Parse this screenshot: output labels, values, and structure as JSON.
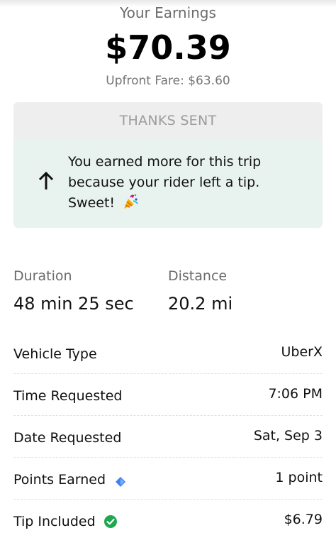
{
  "earnings": {
    "label": "Your Earnings",
    "amount": "$70.39",
    "upfront_fare": "Upfront Fare: $63.60"
  },
  "thanks_button": {
    "label": "THANKS SENT"
  },
  "tip_banner": {
    "message": "You earned more for this trip because your rider left a tip. Sweet!",
    "icon": "arrow-up-icon",
    "emoji_icon": "party-popper-icon",
    "background_color": "#e8f2ee"
  },
  "stats": {
    "duration_label": "Duration",
    "duration_value": "48 min 25 sec",
    "distance_label": "Distance",
    "distance_value": "20.2 mi"
  },
  "details": [
    {
      "label": "Vehicle Type",
      "value": "UberX"
    },
    {
      "label": "Time Requested",
      "value": "7:06 PM"
    },
    {
      "label": "Date Requested",
      "value": "Sat, Sep 3"
    },
    {
      "label": "Points Earned",
      "value": "1 point",
      "icon": "diamond-icon",
      "icon_color": "#3b82f6"
    },
    {
      "label": "Tip Included",
      "value": "$6.79",
      "icon": "check-circle-icon",
      "icon_color": "#1fa84f"
    }
  ]
}
